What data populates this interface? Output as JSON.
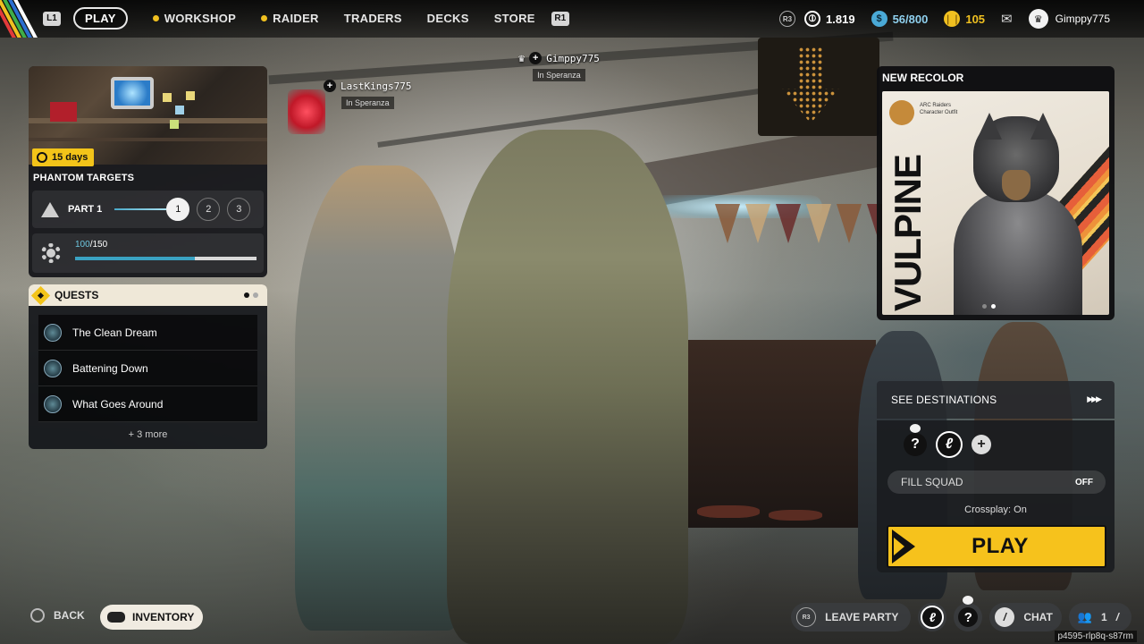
{
  "nav": {
    "l1_hint": "L1",
    "r1_hint": "R1",
    "tabs": [
      {
        "label": "PLAY",
        "active": true,
        "dot": false
      },
      {
        "label": "WORKSHOP",
        "active": false,
        "dot": true
      },
      {
        "label": "RAIDER",
        "active": false,
        "dot": true
      },
      {
        "label": "TRADERS",
        "active": false,
        "dot": false
      },
      {
        "label": "DECKS",
        "active": false,
        "dot": false
      },
      {
        "label": "STORE",
        "active": false,
        "dot": false
      }
    ]
  },
  "stats": {
    "r3_hint": "R3",
    "currency1": "1.819",
    "stash": "56/800",
    "currency2": "105",
    "username": "Gimppy775"
  },
  "players": {
    "left": {
      "name": "LastKings775",
      "location": "In Speranza"
    },
    "right": {
      "name": "Gimppy775",
      "location": "In Speranza"
    }
  },
  "event": {
    "timer": "15  days",
    "title": "PHANTOM TARGETS",
    "part_label": "PART 1",
    "steps": [
      "1",
      "2",
      "3"
    ],
    "progress_current": "100",
    "progress_total": "/150",
    "progress_fraction": 0.66
  },
  "quests": {
    "title": "QUESTS",
    "items": [
      "The Clean Dream",
      "Battening Down",
      "What Goes Around"
    ],
    "more": "+ 3 more"
  },
  "recolor": {
    "title": "NEW RECOLOR",
    "brand_text": "ARC Raiders Character Outfit",
    "name": "VULPINE"
  },
  "squad": {
    "destinations": "SEE DESTINATIONS",
    "fill_squad": "FILL SQUAD",
    "fill_state": "OFF",
    "crossplay": "Crossplay: On",
    "play": "PLAY"
  },
  "bottom": {
    "back": "BACK",
    "inventory": "INVENTORY",
    "r3_hint": "R3",
    "leave_party": "LEAVE PARTY",
    "chat": "CHAT",
    "party_count": "1",
    "build_id": "p4595-rlp8q-s87rm"
  },
  "colors": {
    "accent_yellow": "#f6c21c",
    "progress_blue": "#3aa2c2",
    "stripes": [
      "#e23a3a",
      "#f0c020",
      "#3fae49",
      "#2a6fd1",
      "#ffffff"
    ]
  }
}
